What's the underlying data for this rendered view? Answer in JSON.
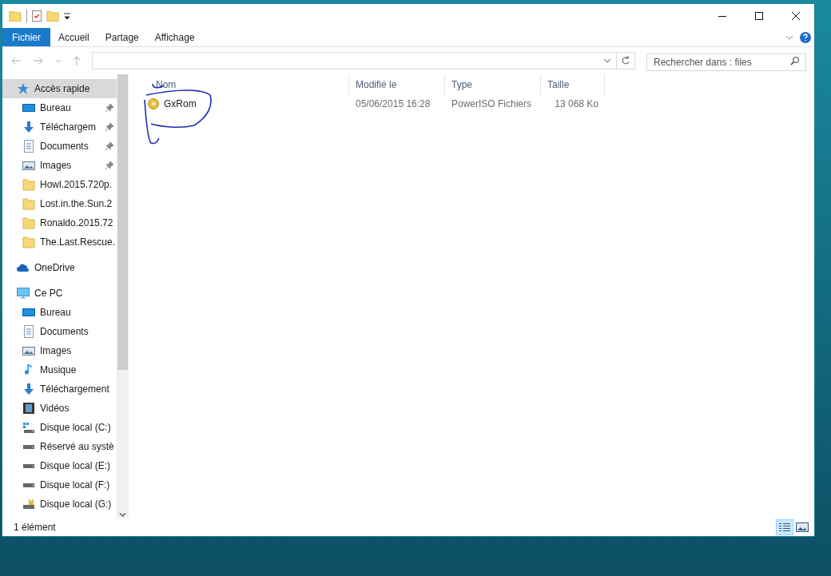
{
  "ribbon": {
    "tabs": [
      {
        "label": "Fichier",
        "kind": "file",
        "selected": false
      },
      {
        "label": "Accueil",
        "kind": "tab",
        "selected": false
      },
      {
        "label": "Partage",
        "kind": "tab",
        "selected": false
      },
      {
        "label": "Affichage",
        "kind": "tab",
        "selected": false
      }
    ]
  },
  "navigation": {
    "search": {
      "placeholder": "Rechercher dans : files"
    }
  },
  "sidebar": {
    "items": [
      {
        "label": "Accès rapide",
        "kind": "star",
        "selected": true,
        "children": [
          {
            "label": "Bureau",
            "kind": "desktop",
            "pinned": true,
            "selected": false
          },
          {
            "label": "Téléchargem",
            "kind": "download",
            "pinned": true,
            "selected": false
          },
          {
            "label": "Documents",
            "kind": "document",
            "pinned": true,
            "selected": false
          },
          {
            "label": "Images",
            "kind": "image",
            "pinned": true,
            "selected": false
          },
          {
            "label": "Howl.2015.720p.",
            "kind": "folder",
            "pinned": false,
            "selected": false
          },
          {
            "label": "Lost.in.the.Sun.2",
            "kind": "folder",
            "pinned": false,
            "selected": false
          },
          {
            "label": "Ronaldo.2015.72",
            "kind": "folder",
            "pinned": false,
            "selected": false
          },
          {
            "label": "The.Last.Rescue.",
            "kind": "folder",
            "pinned": false,
            "selected": false
          }
        ]
      },
      {
        "label": "OneDrive",
        "kind": "cloud",
        "selected": false
      },
      {
        "label": "Ce PC",
        "kind": "pc",
        "selected": false,
        "children": [
          {
            "label": "Bureau",
            "kind": "desktop",
            "pinned": false,
            "selected": false
          },
          {
            "label": "Documents",
            "kind": "document",
            "pinned": false,
            "selected": false
          },
          {
            "label": "Images",
            "kind": "image",
            "pinned": false,
            "selected": false
          },
          {
            "label": "Musique",
            "kind": "music",
            "pinned": false,
            "selected": false
          },
          {
            "label": "Téléchargement",
            "kind": "download",
            "pinned": false,
            "selected": false
          },
          {
            "label": "Vidéos",
            "kind": "video",
            "pinned": false,
            "selected": false
          },
          {
            "label": "Disque local (C:)",
            "kind": "system-drive",
            "pinned": false,
            "selected": false
          },
          {
            "label": "Réservé au systè",
            "kind": "drive",
            "pinned": false,
            "selected": false
          },
          {
            "label": "Disque local (E:)",
            "kind": "drive",
            "pinned": false,
            "selected": false
          },
          {
            "label": "Disque local (F:)",
            "kind": "drive",
            "pinned": false,
            "selected": false
          },
          {
            "label": "Disque local (G:)",
            "kind": "locked-drive",
            "pinned": false,
            "selected": false
          }
        ]
      }
    ]
  },
  "table": {
    "columns": [
      "Nom",
      "Modifié le",
      "Type",
      "Taille"
    ],
    "rows": [
      {
        "name": "GxRom",
        "modified": "05/06/2015 16:28",
        "type": "PowerISO Fichiers",
        "size": "13 068 Ko",
        "selected": false
      }
    ]
  },
  "status_bar": {
    "text": "1 élément",
    "views": [
      {
        "kind": "details",
        "selected": true
      },
      {
        "kind": "large-icons",
        "selected": false
      }
    ]
  }
}
